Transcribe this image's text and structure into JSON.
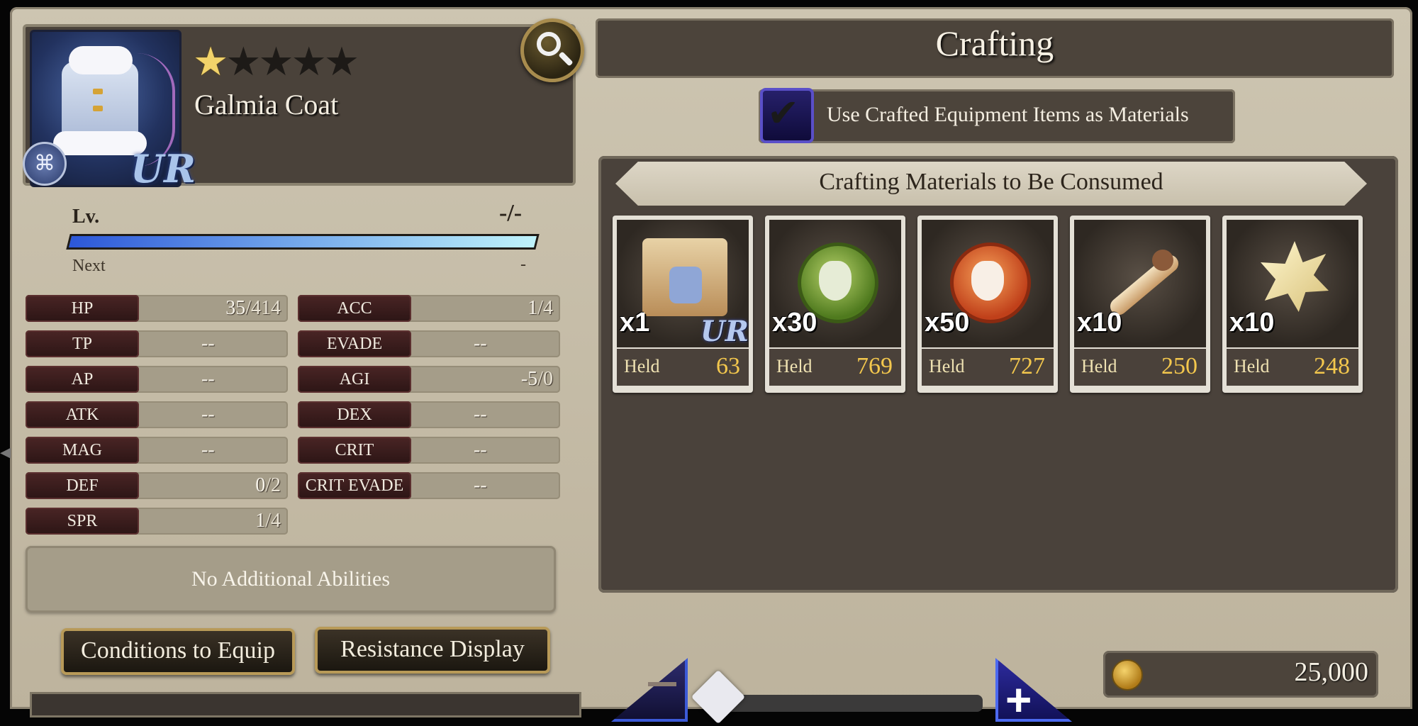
{
  "item": {
    "name": "Galmia Coat",
    "rarity_label": "UR",
    "stars_filled": 1,
    "stars_total": 5
  },
  "level": {
    "label": "Lv.",
    "value": "-/-",
    "next_label": "Next",
    "next_value": "-"
  },
  "stats_left": [
    {
      "label": "HP",
      "current": "35",
      "max": "/414"
    },
    {
      "label": "TP",
      "value": "--"
    },
    {
      "label": "AP",
      "value": "--"
    },
    {
      "label": "ATK",
      "value": "--"
    },
    {
      "label": "MAG",
      "value": "--"
    },
    {
      "label": "DEF",
      "current": "0",
      "max": "/2"
    },
    {
      "label": "SPR",
      "current": "1",
      "max": "/4"
    }
  ],
  "stats_right": [
    {
      "label": "ACC",
      "current": "1",
      "max": "/4"
    },
    {
      "label": "EVADE",
      "value": "--"
    },
    {
      "label": "AGI",
      "current": "-5",
      "max": "/0"
    },
    {
      "label": "DEX",
      "value": "--"
    },
    {
      "label": "CRIT",
      "value": "--"
    },
    {
      "label": "CRIT EVADE",
      "value": "--"
    }
  ],
  "abilities_text": "No Additional Abilities",
  "buttons": {
    "conditions": "Conditions to Equip",
    "resistance": "Resistance Display"
  },
  "crafting": {
    "title": "Crafting",
    "use_crafted_label": "Use Crafted Equipment Items as Materials",
    "use_crafted_checked": true,
    "materials_header": "Crafting Materials to Be Consumed",
    "held_label": "Held",
    "materials": [
      {
        "qty": "x1",
        "held": "63",
        "icon": "recipe-scroll-icon",
        "ur": "UR"
      },
      {
        "qty": "x30",
        "held": "769",
        "icon": "green-mask-icon"
      },
      {
        "qty": "x50",
        "held": "727",
        "icon": "orange-mask-icon"
      },
      {
        "qty": "x10",
        "held": "250",
        "icon": "bone-icon"
      },
      {
        "qty": "x10",
        "held": "248",
        "icon": "crystal-cluster-icon"
      }
    ]
  },
  "gil": "25,000",
  "colors": {
    "panel_dark": "#4a423b",
    "panel_light": "#bdb39d",
    "held_value": "#f3c74d",
    "star": "#f2d36a",
    "accent_blue": "#3c5ad8"
  }
}
